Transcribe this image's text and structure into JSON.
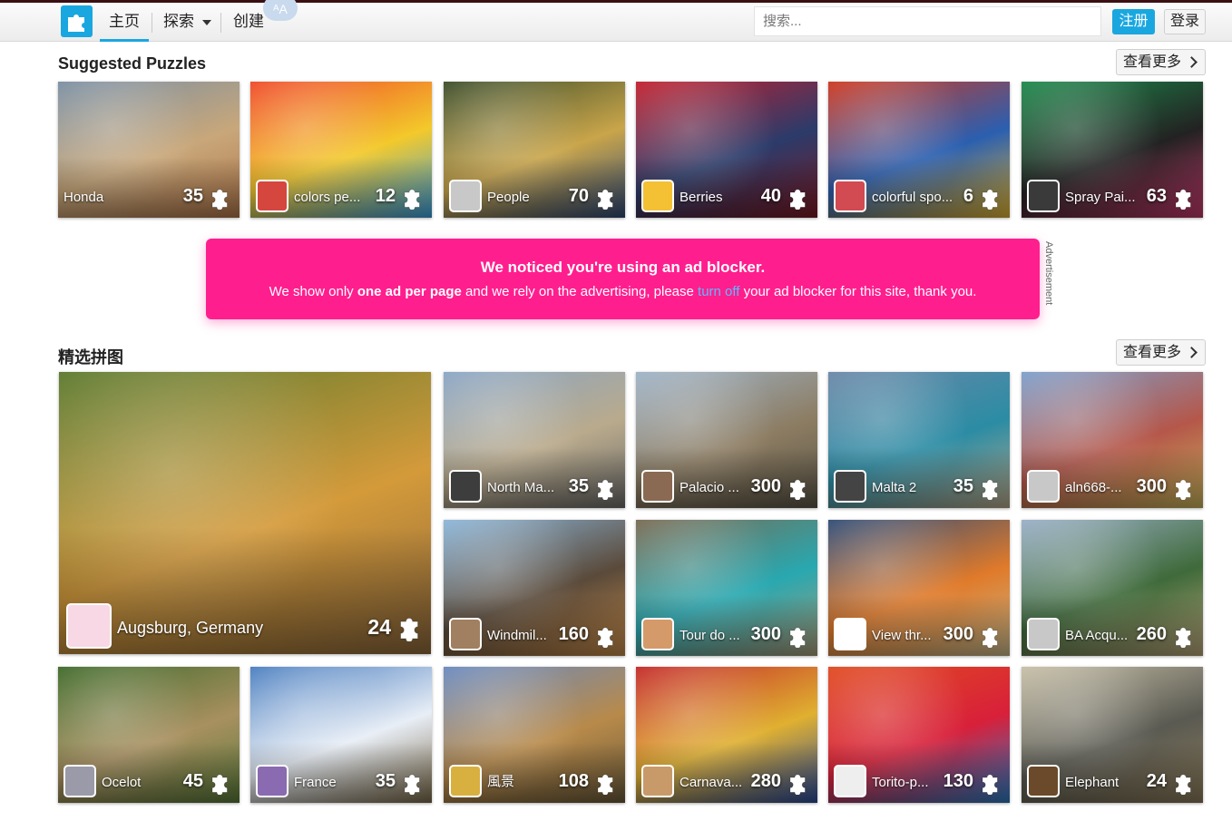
{
  "header": {
    "nav": {
      "home": "主页",
      "explore": "探索",
      "create": "创建"
    },
    "translate_badge": "ᴬA",
    "search_placeholder": "搜索...",
    "register": "注册",
    "login": "登录"
  },
  "suggested": {
    "title": "Suggested Puzzles",
    "more": "查看更多",
    "items": [
      {
        "name": "Honda",
        "count": "35",
        "colors": [
          "#7a8fa3",
          "#c8a77a",
          "#b0764a"
        ],
        "avatar": false
      },
      {
        "name": "colors pe...",
        "count": "12",
        "colors": [
          "#f04a2a",
          "#f3c92b",
          "#3aa0e0"
        ],
        "avatar": true,
        "avatar_color": "#d5463f"
      },
      {
        "name": "People",
        "count": "70",
        "colors": [
          "#3b4d2a",
          "#c9a54a",
          "#304a77"
        ],
        "avatar": true,
        "avatar_color": "#c8c8c8"
      },
      {
        "name": "Berries",
        "count": "40",
        "colors": [
          "#c4202e",
          "#2b3b6a",
          "#7a1a24"
        ],
        "avatar": true,
        "avatar_color": "#f4c034"
      },
      {
        "name": "colorful spo...",
        "count": "6",
        "colors": [
          "#d0381f",
          "#2a5fb0",
          "#e0b230"
        ],
        "avatar": true,
        "avatar_color": "#d24a52"
      },
      {
        "name": "Spray Pai...",
        "count": "63",
        "colors": [
          "#1e8a4c",
          "#222222",
          "#c23a6a"
        ],
        "avatar": true,
        "avatar_color": "#3a3a3a"
      }
    ]
  },
  "ad": {
    "title": "We noticed you're using an ad blocker.",
    "text_before": "We show only ",
    "text_bold": "one ad per page",
    "text_middle": " and we rely on the advertising, please ",
    "link": "turn off",
    "text_after": " your ad blocker for this site, thank you.",
    "side_label": "Advertisement"
  },
  "featured": {
    "title": "精选拼图",
    "more": "查看更多",
    "big": {
      "name": "Augsburg, Germany",
      "count": "24",
      "colors": [
        "#5c7a2e",
        "#d49a3a",
        "#8f6a3c"
      ],
      "avatar": true,
      "avatar_color": "#f7d8e4"
    },
    "items": [
      {
        "name": "North Ma...",
        "count": "35",
        "colors": [
          "#8aa6c5",
          "#b9aa8c",
          "#6d6c6a"
        ],
        "avatar": true,
        "avatar_color": "#3d3d3d"
      },
      {
        "name": "Palacio ...",
        "count": "300",
        "colors": [
          "#9fb4c8",
          "#8c7c62",
          "#5b5547"
        ],
        "avatar": true,
        "avatar_color": "#8a6a52"
      },
      {
        "name": "Malta 2",
        "count": "35",
        "colors": [
          "#6b88a8",
          "#2b8ca4",
          "#b7a88a"
        ],
        "avatar": true,
        "avatar_color": "#444444"
      },
      {
        "name": "aln668-...",
        "count": "300",
        "colors": [
          "#7ea0cc",
          "#b5574a",
          "#c7b25a"
        ],
        "avatar": true,
        "avatar_color": "#c8c8c8"
      },
      {
        "name": "Windmil...",
        "count": "160",
        "colors": [
          "#8db7da",
          "#5a4a3a",
          "#c48a4a"
        ],
        "avatar": true,
        "avatar_color": "#a08060"
      },
      {
        "name": "Tour do ...",
        "count": "300",
        "colors": [
          "#7a6a52",
          "#28a8b0",
          "#a89a78"
        ],
        "avatar": true,
        "avatar_color": "#d49a6a"
      },
      {
        "name": "View thr...",
        "count": "300",
        "colors": [
          "#2f4d78",
          "#e07a2a",
          "#c8b88a"
        ],
        "avatar": true,
        "avatar_color": "#ffffff"
      },
      {
        "name": "BA Acqu...",
        "count": "260",
        "colors": [
          "#9ab0c8",
          "#3f6a3a",
          "#b8a47a"
        ],
        "avatar": true,
        "avatar_color": "#c8c8c8"
      },
      {
        "name": "Ocelot",
        "count": "45",
        "colors": [
          "#3f6a2a",
          "#a89060",
          "#5a7a3a"
        ],
        "avatar": true,
        "avatar_color": "#9a9aa8"
      },
      {
        "name": "France",
        "count": "35",
        "colors": [
          "#4a7ec0",
          "#e8eef6",
          "#7a6a4a"
        ],
        "avatar": true,
        "avatar_color": "#8a6ab0"
      },
      {
        "name": "風景",
        "count": "108",
        "colors": [
          "#6a8ac0",
          "#b88a4a",
          "#6a5a3a"
        ],
        "avatar": true,
        "avatar_color": "#d8b040"
      },
      {
        "name": "Carnava...",
        "count": "280",
        "colors": [
          "#c42a2a",
          "#e0b030",
          "#2a4a9a"
        ],
        "avatar": true,
        "avatar_color": "#c89a6a"
      },
      {
        "name": "Torito-p...",
        "count": "130",
        "colors": [
          "#e04a20",
          "#d8203a",
          "#2a7ac0"
        ],
        "avatar": true,
        "avatar_color": "#eeeeee"
      },
      {
        "name": "Elephant",
        "count": "24",
        "colors": [
          "#c8c0a8",
          "#5a5a52",
          "#8a7a5a"
        ],
        "avatar": true,
        "avatar_color": "#6a4a2a"
      }
    ]
  }
}
